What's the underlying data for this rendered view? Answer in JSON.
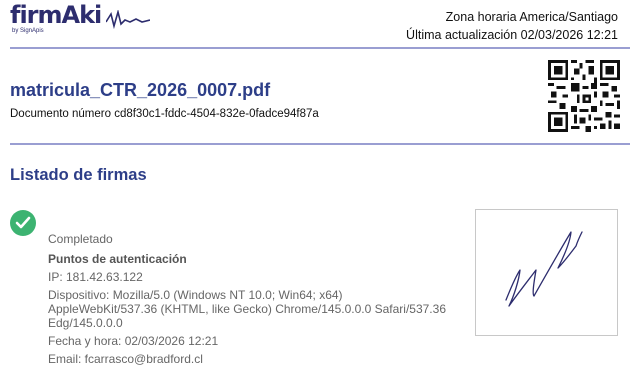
{
  "header": {
    "logo_text": "firmAki",
    "logo_sub": "by SignApis",
    "timezone": "Zona horaria America/Santiago",
    "last_update": "Última actualización 02/03/2026 12:21"
  },
  "document": {
    "title": "matricula_CTR_2026_0007.pdf",
    "number": "Documento número cd8f30c1-fddc-4504-832e-0fadce94f87a"
  },
  "signatures": {
    "section_title": "Listado de firmas",
    "items": [
      {
        "status": "Completado",
        "auth_heading": "Puntos de autenticación",
        "ip": "IP: 181.42.63.122",
        "device": "Dispositivo: Mozilla/5.0 (Windows NT 10.0; Win64; x64) AppleWebKit/537.36 (KHTML, like Gecko) Chrome/145.0.0.0 Safari/537.36 Edg/145.0.0.0",
        "datetime": "Fecha y hora: 02/03/2026 12:21",
        "email": "Email: fcarrasco@bradford.cl"
      }
    ]
  },
  "colors": {
    "brand": "#2d2d6e",
    "title": "#2d3e88",
    "rule": "#9a9ed2",
    "success": "#3cb371"
  }
}
